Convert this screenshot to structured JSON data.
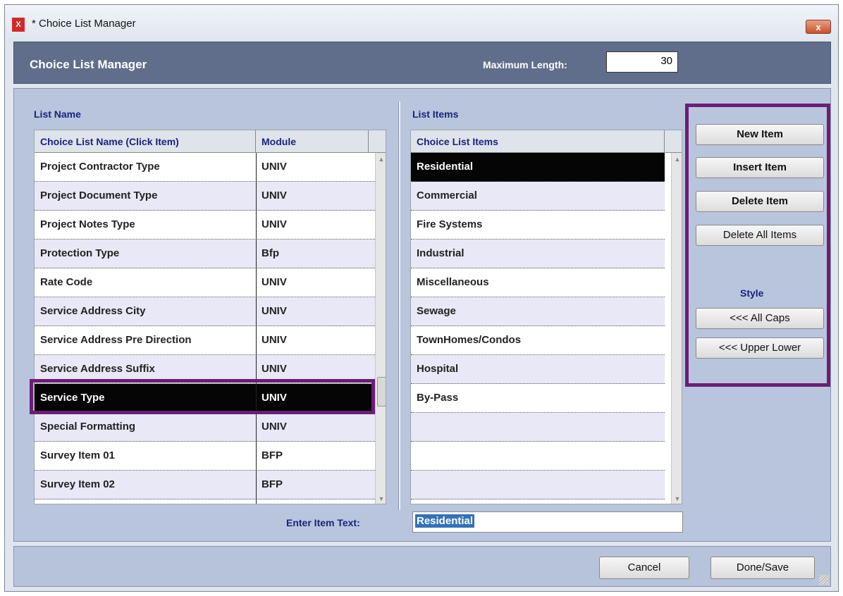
{
  "window": {
    "title": "* Choice List Manager",
    "icon": "xf-app-icon",
    "close_label": "x"
  },
  "header": {
    "title": "Choice List Manager",
    "max_length_label": "Maximum Length:",
    "max_length_value": "30"
  },
  "list_name": {
    "section_label": "List Name",
    "columns": [
      "Choice List Name (Click Item)",
      "Module"
    ],
    "rows": [
      {
        "name": "Project Contractor Type",
        "module": "UNIV"
      },
      {
        "name": "Project Document Type",
        "module": "UNIV"
      },
      {
        "name": "Project Notes Type",
        "module": "UNIV"
      },
      {
        "name": "Protection Type",
        "module": "Bfp"
      },
      {
        "name": "Rate Code",
        "module": "UNIV"
      },
      {
        "name": "Service Address City",
        "module": "UNIV"
      },
      {
        "name": "Service Address Pre Direction",
        "module": "UNIV"
      },
      {
        "name": "Service Address Suffix",
        "module": "UNIV"
      },
      {
        "name": "Service Type",
        "module": "UNIV"
      },
      {
        "name": "Special Formatting",
        "module": "UNIV"
      },
      {
        "name": "Survey Item 01",
        "module": "BFP"
      },
      {
        "name": "Survey Item 02",
        "module": "BFP"
      }
    ],
    "selected_index": 8
  },
  "list_items": {
    "section_label": "List Items",
    "column": "Choice List Items",
    "rows": [
      "Residential",
      "Commercial",
      "Fire Systems",
      "Industrial",
      "Miscellaneous",
      "Sewage",
      "TownHomes/Condos",
      "Hospital",
      "By-Pass",
      "",
      "",
      ""
    ],
    "selected_index": 0
  },
  "buttons": {
    "new_item": "New Item",
    "insert_item": "Insert Item",
    "delete_item": "Delete Item",
    "delete_all": "Delete All Items"
  },
  "style": {
    "label": "Style",
    "all_caps": "<<<  All Caps",
    "upper_lower": "<<<  Upper Lower"
  },
  "entry": {
    "label": "Enter Item Text:",
    "value": "Residential"
  },
  "footer": {
    "cancel": "Cancel",
    "done": "Done/Save"
  },
  "colors": {
    "header_bg": "#616e8b",
    "content_bg": "#b9c5dd",
    "selection_bg": "#050505",
    "highlight_border": "#6b1e74",
    "label_text": "#1a237e"
  }
}
